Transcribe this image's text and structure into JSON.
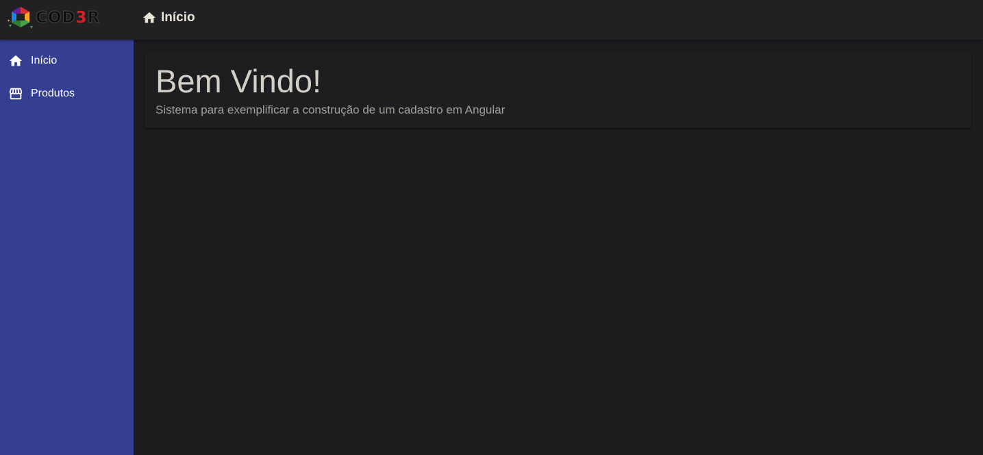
{
  "header": {
    "logo": {
      "text_pre": "COD",
      "text_three": "3",
      "text_post": "R"
    },
    "title": "Início",
    "title_icon": "home-icon"
  },
  "sidebar": {
    "items": [
      {
        "label": "Início",
        "icon": "home-icon"
      },
      {
        "label": "Produtos",
        "icon": "storefront-icon"
      }
    ]
  },
  "main": {
    "card": {
      "title": "Bem Vindo!",
      "subtitle": "Sistema para exemplificar a construção de um cadastro em Angular"
    }
  },
  "colors": {
    "toolbar": "#212123",
    "sidebar": "#353f92",
    "background": "#1d1d20",
    "logo_accent": "#d81f26"
  }
}
